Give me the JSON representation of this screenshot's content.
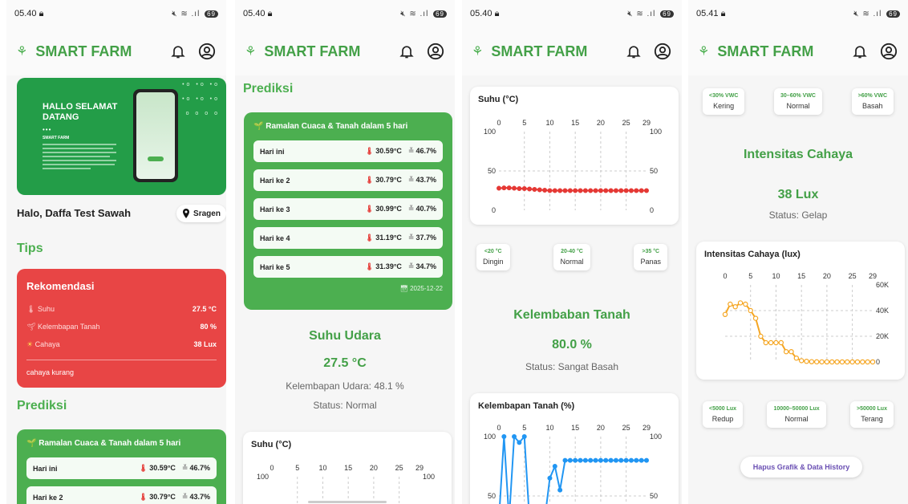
{
  "colors": {
    "green": "#4caf50",
    "red": "#e84545",
    "temp_line": "#e53935",
    "moist_line": "#2196f3",
    "light_line": "#f5a623"
  },
  "app": {
    "title": "SMART FARM"
  },
  "screens": [
    {
      "time": "05.40"
    },
    {
      "time": "05.40"
    },
    {
      "time": "05.40"
    },
    {
      "time": "05.41"
    }
  ],
  "home": {
    "banner_title": "HALLO SELAMAT DATANG",
    "banner_dots": "•••",
    "banner_heading": "SMART FARM",
    "greeting": "Halo, Daffa Test Sawah",
    "location": "Sragen",
    "tips_title": "Tips",
    "recommendation": {
      "title": "Rekomendasi",
      "rows": [
        {
          "label": "Suhu",
          "value": "27.5 °C"
        },
        {
          "label": "Kelembapan Tanah",
          "value": "80 %"
        },
        {
          "label": "Cahaya",
          "value": "38 Lux"
        }
      ],
      "note": "cahaya kurang"
    },
    "prediction_title": "Prediksi"
  },
  "forecast": {
    "title": "🌱 Ramalan Cuaca & Tanah dalam 5 hari",
    "days": [
      {
        "day": "Hari ini",
        "temp": "30.59°C",
        "humidity": "46.7%"
      },
      {
        "day": "Hari ke 2",
        "temp": "30.79°C",
        "humidity": "43.7%"
      },
      {
        "day": "Hari ke 3",
        "temp": "30.99°C",
        "humidity": "40.7%"
      },
      {
        "day": "Hari ke 4",
        "temp": "31.19°C",
        "humidity": "37.7%"
      },
      {
        "day": "Hari ke 5",
        "temp": "31.39°C",
        "humidity": "34.7%"
      }
    ],
    "date": "2025-12-22"
  },
  "air": {
    "title": "Suhu Udara",
    "value": "27.5 °C",
    "humidity": "Kelembapan Udara: 48.1 %",
    "status": "Status: Normal"
  },
  "temp_legend": [
    {
      "range": "<20 °C",
      "name": "Dingin"
    },
    {
      "range": "20-40 °C",
      "name": "Normal"
    },
    {
      "range": ">35 °C",
      "name": "Panas"
    }
  ],
  "soil": {
    "title": "Kelembaban Tanah",
    "value": "80.0 %",
    "status": "Status: Sangat Basah"
  },
  "soil_legend": [
    {
      "range": "<30% VWC",
      "name": "Kering"
    },
    {
      "range": "30–60% VWC",
      "name": "Normal"
    },
    {
      "range": ">60% VWC",
      "name": "Basah"
    }
  ],
  "light": {
    "title": "Intensitas Cahaya",
    "value": "38 Lux",
    "status": "Status: Gelap"
  },
  "light_legend": [
    {
      "range": "<5000 Lux",
      "name": "Redup"
    },
    {
      "range": "10000–50000 Lux",
      "name": "Normal"
    },
    {
      "range": ">50000 Lux",
      "name": "Terang"
    }
  ],
  "clear_button": "Hapus Grafik & Data History",
  "chart_data": [
    {
      "type": "line",
      "title": "Suhu (°C)",
      "xlim": [
        0,
        29
      ],
      "ylim": [
        0,
        100
      ],
      "xticks": [
        "0",
        "5",
        "10",
        "15",
        "20",
        "25",
        "29"
      ],
      "yticks": [
        "100",
        "50",
        "0"
      ],
      "x": [
        0,
        1,
        2,
        3,
        4,
        5,
        6,
        7,
        8,
        9,
        10,
        11,
        12,
        13,
        14,
        15,
        16,
        17,
        18,
        19,
        20,
        21,
        22,
        23,
        24,
        25,
        26,
        27,
        28,
        29
      ],
      "series": [
        {
          "values": [
            28,
            28.5,
            28.5,
            28,
            27.5,
            27.5,
            27,
            26.5,
            26,
            25.5,
            25,
            25,
            25,
            25,
            25,
            25,
            25,
            25,
            25,
            25,
            25,
            25,
            25,
            25,
            25,
            25,
            25,
            25,
            25,
            25
          ]
        }
      ]
    },
    {
      "type": "line",
      "title": "Kelembapan Tanah (%)",
      "xlim": [
        0,
        29
      ],
      "ylim": [
        0,
        100
      ],
      "xticks": [
        "0",
        "5",
        "10",
        "15",
        "20",
        "25",
        "29"
      ],
      "yticks": [
        "100",
        "50"
      ],
      "x": [
        0,
        1,
        2,
        3,
        4,
        5,
        6,
        7,
        8,
        9,
        10,
        11,
        12,
        13,
        14,
        15,
        16,
        17,
        18,
        19,
        20,
        21,
        22,
        23,
        24,
        25,
        26,
        27,
        28,
        29
      ],
      "series": [
        {
          "values": [
            0,
            100,
            0,
            100,
            95,
            100,
            0,
            0,
            0,
            0,
            65,
            75,
            55,
            80,
            80,
            80,
            80,
            80,
            80,
            80,
            80,
            80,
            80,
            80,
            80,
            80,
            80,
            80,
            80,
            80
          ]
        }
      ]
    },
    {
      "type": "line",
      "title": "Intensitas Cahaya (lux)",
      "xlim": [
        0,
        29
      ],
      "ylim": [
        0,
        60000
      ],
      "xticks": [
        "0",
        "5",
        "10",
        "15",
        "20",
        "25",
        "29"
      ],
      "yticks": [
        "60K",
        "40K",
        "20K",
        "0"
      ],
      "x": [
        0,
        1,
        2,
        3,
        4,
        5,
        6,
        7,
        8,
        9,
        10,
        11,
        12,
        13,
        14,
        15,
        16,
        17,
        18,
        19,
        20,
        21,
        22,
        23,
        24,
        25,
        26,
        27,
        28,
        29
      ],
      "series": [
        {
          "values": [
            37000,
            45000,
            43000,
            46000,
            45000,
            40000,
            34000,
            20000,
            15000,
            15000,
            15000,
            15000,
            8000,
            8000,
            3000,
            1000,
            500,
            200,
            100,
            50,
            40,
            38,
            38,
            38,
            38,
            38,
            38,
            38,
            38,
            38
          ]
        }
      ]
    }
  ]
}
